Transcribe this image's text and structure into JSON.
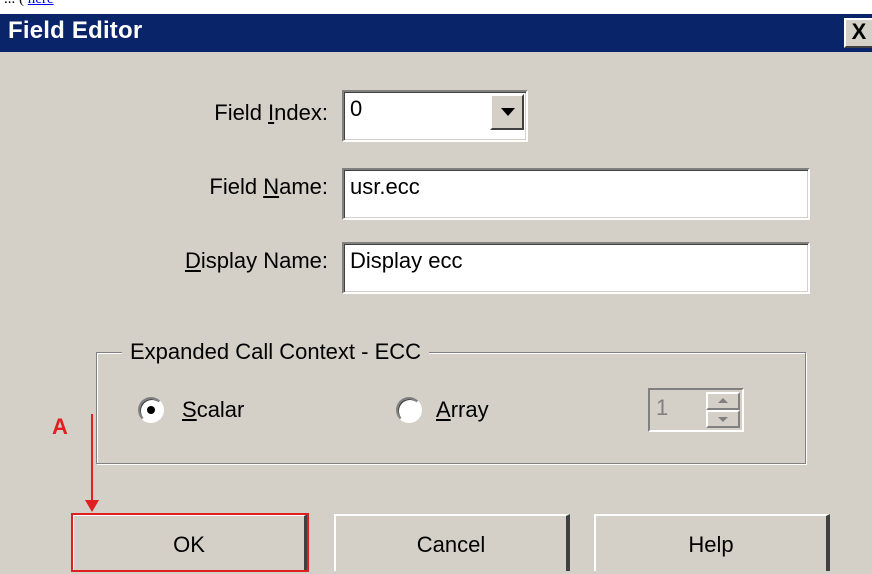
{
  "background_page": {
    "text_before": "...                    (                                      ",
    "link": "here",
    "text_after": ""
  },
  "dialog": {
    "title": "Field Editor",
    "close_glyph": "X"
  },
  "fields": {
    "field_index": {
      "label_pre": "Field ",
      "label_key": "I",
      "label_post": "ndex:",
      "value": "0"
    },
    "field_name": {
      "label_pre": "Field ",
      "label_key": "N",
      "label_post": "ame:",
      "value": "usr.ecc"
    },
    "display_name": {
      "label_pre": "",
      "label_key": "D",
      "label_post": "isplay Name:",
      "value": "Display ecc"
    }
  },
  "group": {
    "title": "Expanded Call Context - ECC",
    "scalar": {
      "key": "S",
      "rest": "calar",
      "checked": true
    },
    "array": {
      "key": "A",
      "rest": "rray",
      "checked": false
    },
    "array_size": "1"
  },
  "buttons": {
    "ok": "OK",
    "cancel": "Cancel",
    "help": "Help"
  },
  "annotation": {
    "letter": "A",
    "color": "#e02020"
  },
  "colors": {
    "dialog_bg": "#d4d0c8",
    "titlebar": "#0a246a"
  }
}
